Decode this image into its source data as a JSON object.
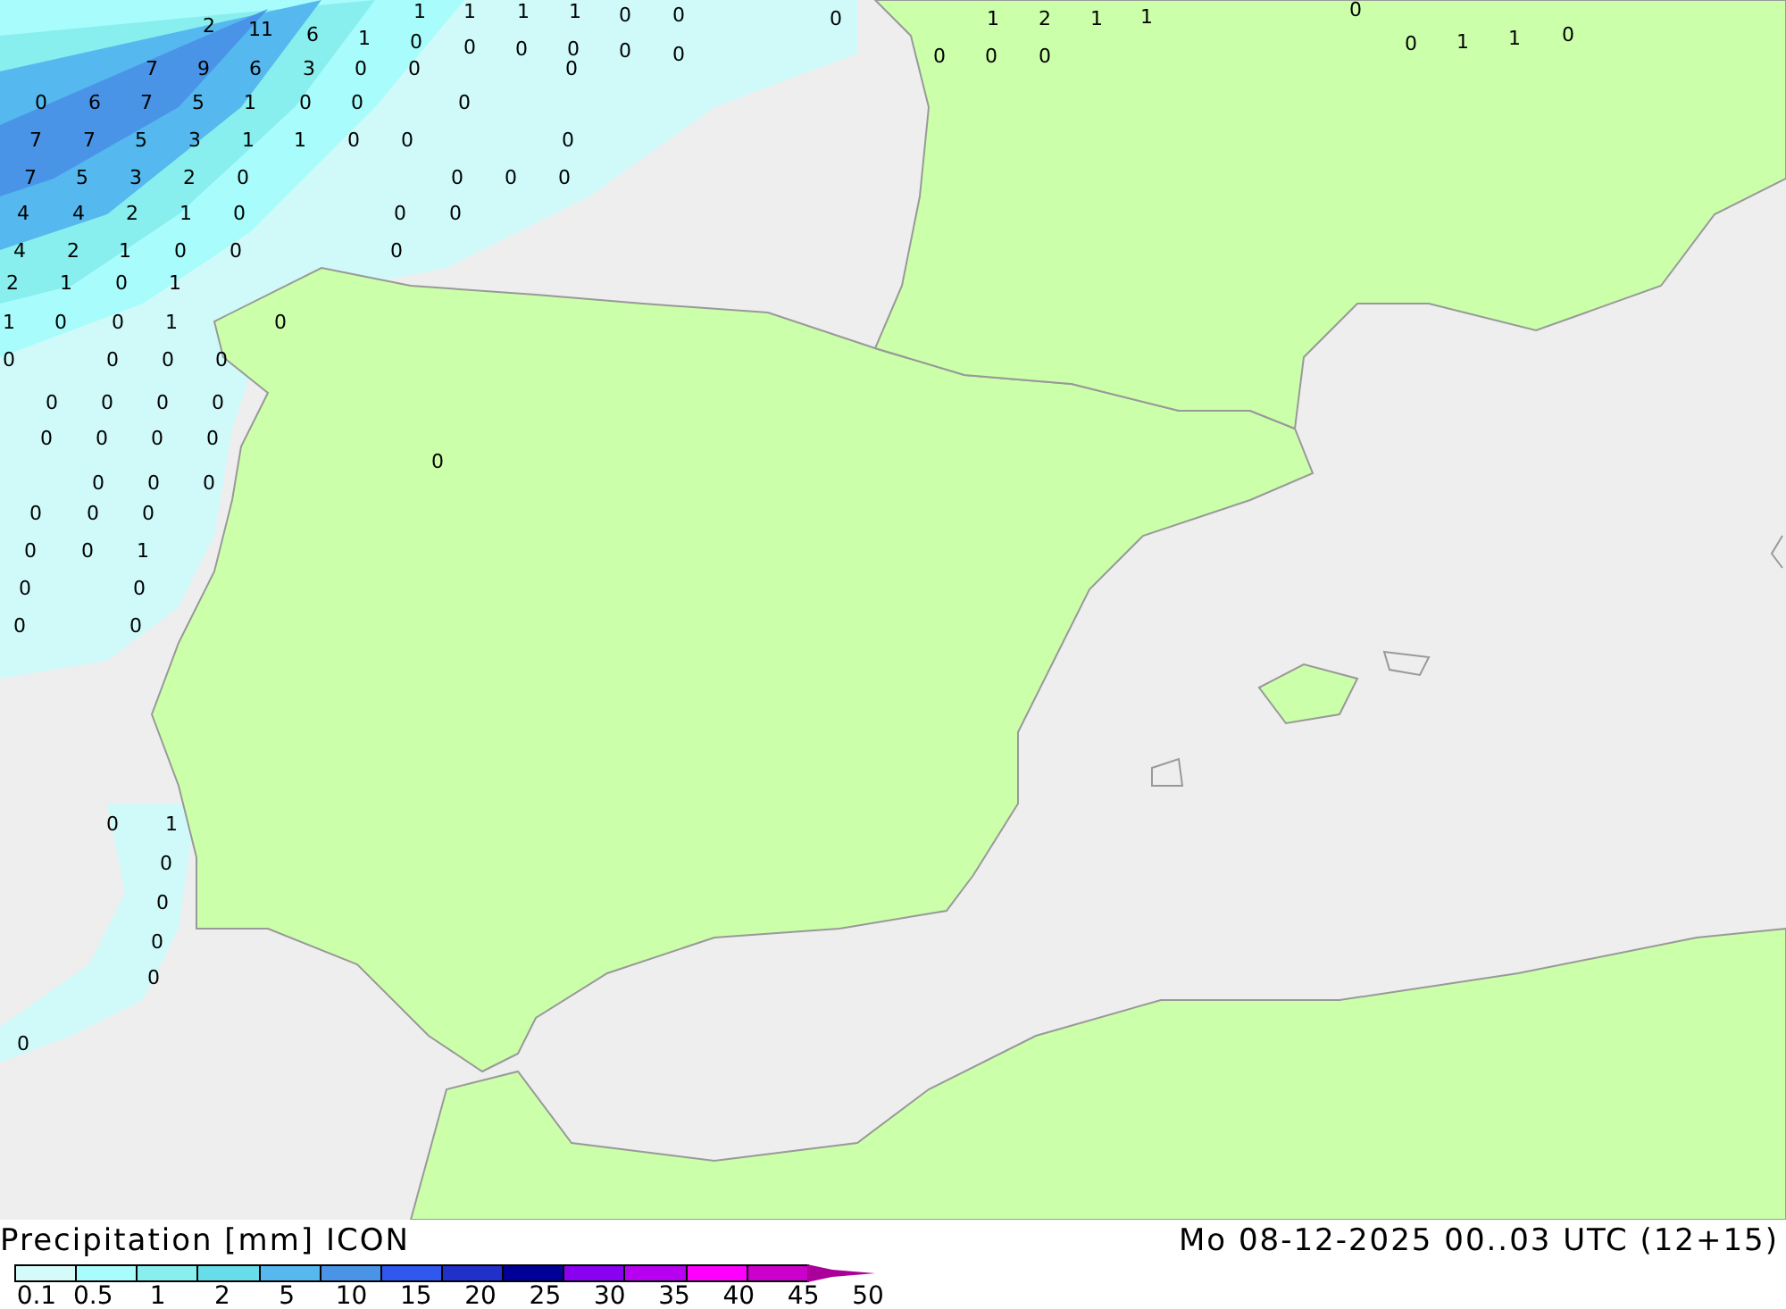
{
  "map_labels": [
    "1",
    "1",
    "1",
    "1",
    "0",
    "0",
    "0",
    "1",
    "2",
    "1",
    "1",
    "0",
    "2",
    "11",
    "6",
    "1",
    "0",
    "0",
    "0",
    "0",
    "0",
    "0",
    "0",
    "0",
    "0",
    "0",
    "1",
    "1",
    "0",
    "7",
    "9",
    "6",
    "3",
    "0",
    "0",
    "0",
    "0",
    "6",
    "7",
    "5",
    "1",
    "0",
    "0",
    "0",
    "7",
    "7",
    "5",
    "3",
    "1",
    "1",
    "0",
    "0",
    "0",
    "7",
    "5",
    "3",
    "2",
    "0",
    "0",
    "0",
    "0",
    "4",
    "4",
    "2",
    "1",
    "0",
    "0",
    "0",
    "4",
    "2",
    "1",
    "0",
    "0",
    "0",
    "2",
    "1",
    "0",
    "1",
    "1",
    "0",
    "0",
    "1",
    "0",
    "0",
    "0",
    "0",
    "0",
    "0",
    "0",
    "0",
    "0",
    "0",
    "0",
    "0",
    "0",
    "0",
    "0",
    "0",
    "0",
    "0",
    "0",
    "0",
    "0",
    "0",
    "1",
    "0",
    "0",
    "0",
    "0",
    "0",
    "1",
    "0",
    "0",
    "0",
    "0",
    "0"
  ],
  "legend": {
    "title": "Precipitation [mm] ICON",
    "run": "Mo 08-12-2025 00..03 UTC (12+15)",
    "bins": [
      {
        "color": "#d4fafa"
      },
      {
        "color": "#a8fcfc"
      },
      {
        "color": "#88eeee"
      },
      {
        "color": "#66dde8"
      },
      {
        "color": "#55b8ee"
      },
      {
        "color": "#4a94e8"
      },
      {
        "color": "#3058ee"
      },
      {
        "color": "#2030c8"
      },
      {
        "color": "#000098"
      },
      {
        "color": "#8a00f0"
      },
      {
        "color": "#b800f0"
      },
      {
        "color": "#ff00ff"
      },
      {
        "color": "#cc00cc"
      }
    ],
    "tip": {
      "color": "#aa0099"
    },
    "labels": [
      "0.1",
      "0.5",
      "1",
      "2",
      "5",
      "10",
      "15",
      "20",
      "25",
      "30",
      "35",
      "40",
      "45",
      "50"
    ]
  }
}
